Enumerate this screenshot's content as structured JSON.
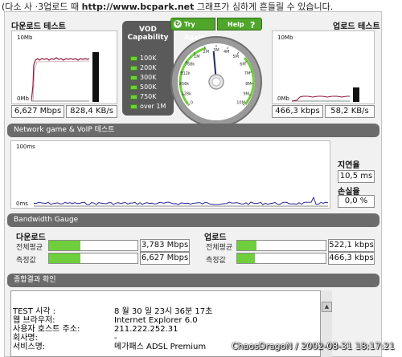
{
  "top_note": {
    "prefix": "(다소 사 ·3업로드 때 ",
    "url": "http://www.bcpark.net",
    "suffix": " 그래프가 심하게 흔들릴 수 있습니다."
  },
  "download_test": {
    "title": "다운로드 테스트",
    "scale_top": "10Mb",
    "scale_bottom": "0Mb",
    "speed_mbps": "6,627 Mbps",
    "speed_kbs": "828,4 KB/s"
  },
  "upload_test": {
    "title": "업로드 테스트",
    "scale_top": "10Mb",
    "scale_bottom": "0Mb",
    "speed_kbps": "466,3 kbps",
    "speed_kbs": "58,2 KB/s"
  },
  "vod": {
    "title_line1": "VOD",
    "title_line2": "Capability",
    "levels": [
      "100K",
      "200K",
      "300K",
      "500K",
      "750K",
      "over 1M"
    ]
  },
  "gauge": {
    "try_again": "Try Again",
    "help": "Help",
    "help_icon": "?",
    "ticks": [
      "0",
      "128k",
      "256k",
      "512k",
      "768k",
      "1M",
      "2M",
      "3M",
      "4M",
      "5M",
      "6M",
      "7M",
      "8M",
      "9M",
      "10M"
    ],
    "needle_value_mbps": 6.627
  },
  "network": {
    "section_title": "Network game & VoIP 테스트",
    "scale_top": "100ms",
    "scale_bottom": "0ms",
    "latency_label": "지연율",
    "latency_value": "10,5 ms",
    "loss_label": "손실율",
    "loss_value": "0,0 %"
  },
  "bandwidth": {
    "section_title": "Bandwidth Gauge",
    "download": {
      "title": "다운로드",
      "avg_label": "전체평균",
      "avg_value": "3,783 Mbps",
      "avg_fill": 0.35,
      "measured_label": "측정값",
      "measured_value": "6,627 Mbps",
      "measured_fill": 0.35
    },
    "upload": {
      "title": "업로드",
      "avg_label": "전체평균",
      "avg_value": "522,1 kbps",
      "avg_fill": 0.22,
      "measured_label": "측정값",
      "measured_value": "466,3 kbps",
      "measured_fill": 0.2
    }
  },
  "summary": {
    "section_title": "종합결과 확인",
    "rows": [
      {
        "key": "TEST 시각 :",
        "value": "8 월 30 일  23시 36분 17초"
      },
      {
        "key": "웹 브라우저:",
        "value": "Internet Explorer 6.0"
      },
      {
        "key": "사용자 호스트 주소:",
        "value": "211.222.252.31"
      },
      {
        "key": "회사명:",
        "value": "-"
      },
      {
        "key": "서비스명:",
        "value": "메가패스 ADSL Premium"
      }
    ]
  },
  "watermark": "ChaosDragoN / 2002-08-31 18:17:21",
  "colors": {
    "accent_green": "#6fce3b",
    "button_green": "#4fa62a",
    "section_gray": "#6b6b6b",
    "graph_download": "#8b1a3a",
    "graph_network": "#2a2a9a"
  }
}
